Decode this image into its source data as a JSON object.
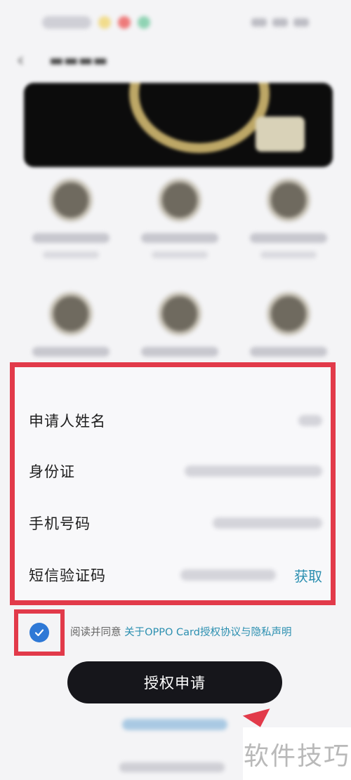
{
  "form": {
    "name_label": "申请人姓名",
    "id_label": "身份证",
    "phone_label": "手机号码",
    "sms_label": "短信验证码",
    "get_code_label": "获取"
  },
  "agreement": {
    "prefix": "阅读并同意",
    "link": "关于OPPO Card授权协议与隐私声明",
    "checked": true
  },
  "submit_label": "授权申请",
  "watermark": "软件技巧",
  "colors": {
    "highlight": "#e23a4a",
    "accent_link": "#2b8fb0",
    "checkbox": "#2e78d6",
    "button_bg": "#16161b"
  },
  "icons": [
    "back-arrow-icon",
    "check-icon"
  ]
}
